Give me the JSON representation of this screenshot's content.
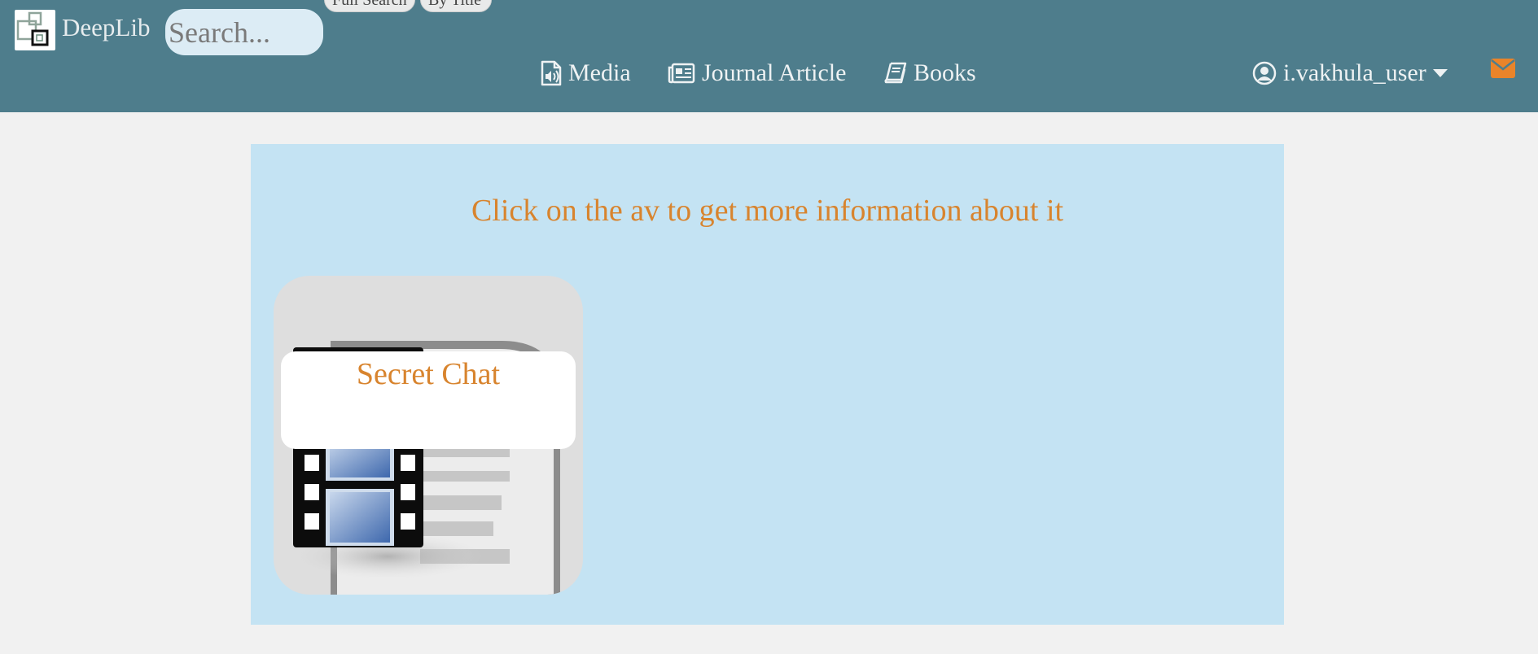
{
  "header": {
    "brand": "DeepLib",
    "search": {
      "placeholder": "Search...",
      "value": ""
    },
    "search_modes": [
      "Full Search",
      "By Title"
    ],
    "nav": [
      {
        "label": "Media",
        "icon": "audio-file-icon"
      },
      {
        "label": "Journal Article",
        "icon": "newspaper-icon"
      },
      {
        "label": "Books",
        "icon": "book-icon"
      }
    ],
    "user": {
      "name": "i.vakhula_user",
      "icon": "user-circle-icon",
      "dropdown_icon": "caret-down-icon"
    },
    "mail_icon": "envelope-icon"
  },
  "main": {
    "hint": "Click on the av to get more information about it",
    "items": [
      {
        "title": "Secret Chat",
        "thumbnail": "video-file-icon"
      }
    ]
  },
  "colors": {
    "navbar": "#4e7d8c",
    "panel": "#c4e3f3",
    "accent": "#d8842e",
    "page_background": "#f1f1f1"
  }
}
